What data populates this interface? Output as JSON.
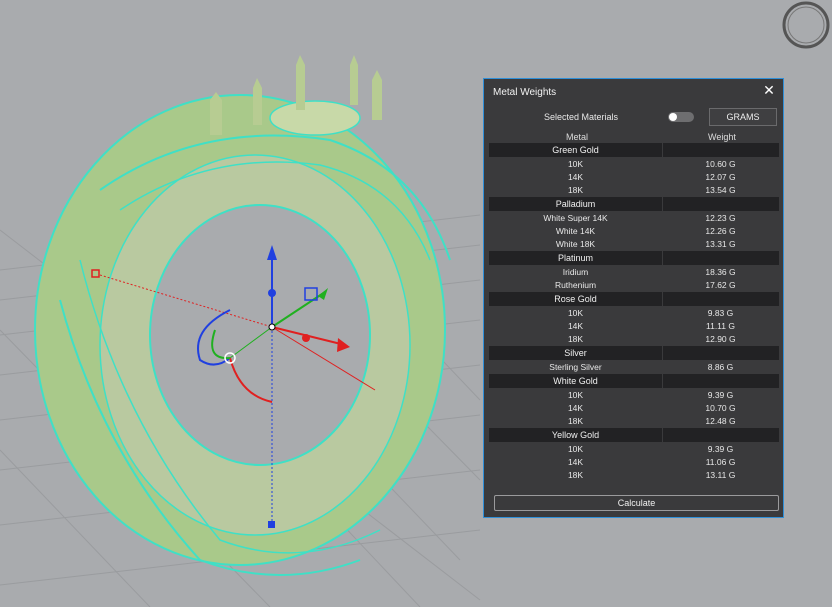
{
  "panel": {
    "title": "Metal Weights",
    "selected_materials_label": "Selected Materials",
    "selected_materials_on": false,
    "units_button": "GRAMS",
    "col_metal": "Metal",
    "col_weight": "Weight",
    "calculate_label": "Calculate",
    "groups": [
      {
        "name": "Green Gold",
        "rows": [
          {
            "metal": "10K",
            "weight": "10.60 G"
          },
          {
            "metal": "14K",
            "weight": "12.07 G"
          },
          {
            "metal": "18K",
            "weight": "13.54 G"
          }
        ]
      },
      {
        "name": "Palladium",
        "rows": [
          {
            "metal": "White Super 14K",
            "weight": "12.23 G"
          },
          {
            "metal": "White 14K",
            "weight": "12.26 G"
          },
          {
            "metal": "White 18K",
            "weight": "13.31 G"
          }
        ]
      },
      {
        "name": "Platinum",
        "rows": [
          {
            "metal": "Iridium",
            "weight": "18.36 G"
          },
          {
            "metal": "Ruthenium",
            "weight": "17.62 G"
          }
        ]
      },
      {
        "name": "Rose Gold",
        "rows": [
          {
            "metal": "10K",
            "weight": "9.83 G"
          },
          {
            "metal": "14K",
            "weight": "11.11 G"
          },
          {
            "metal": "18K",
            "weight": "12.90 G"
          }
        ]
      },
      {
        "name": "Silver",
        "rows": [
          {
            "metal": "Sterling Silver",
            "weight": "8.86 G"
          }
        ]
      },
      {
        "name": "White Gold",
        "rows": [
          {
            "metal": "10K",
            "weight": "9.39 G"
          },
          {
            "metal": "14K",
            "weight": "10.70 G"
          },
          {
            "metal": "18K",
            "weight": "12.48 G"
          }
        ]
      },
      {
        "name": "Yellow Gold",
        "rows": [
          {
            "metal": "10K",
            "weight": "9.39 G"
          },
          {
            "metal": "14K",
            "weight": "11.06 G"
          },
          {
            "metal": "18K",
            "weight": "13.11 G"
          }
        ]
      }
    ]
  },
  "colors": {
    "viewport_bg": "#a9abae",
    "ring_fill": "#a9c98a",
    "wireframe": "#3fe0c6",
    "panel_bg": "#3a3a3c",
    "panel_border": "#2f8fd8",
    "axis_x": "#e02020",
    "axis_y": "#20b020",
    "axis_z": "#2040e0"
  }
}
